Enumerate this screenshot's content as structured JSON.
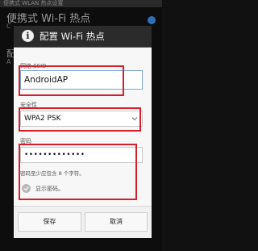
{
  "background": {
    "status_text": "便携式 WLAN 热点设置",
    "title": "便携式 Wi-Fi 热点",
    "sub": "C",
    "item_letter": "配",
    "item_sub": "A"
  },
  "dialog": {
    "title": "配置 Wi-Fi 热点",
    "ssid_label": "网络 SSID",
    "ssid_value": "AndroidAP",
    "security_label": "安全性",
    "security_value": "WPA2 PSK",
    "password_label": "密码",
    "password_value": "•••••••••••••",
    "password_hint": "密码至少应包含 8 个字符。",
    "show_password_label": "显示密码。",
    "save_label": "保存",
    "cancel_label": "取消"
  },
  "colors": {
    "highlight": "#d4202a",
    "accent": "#2f6fb5"
  }
}
